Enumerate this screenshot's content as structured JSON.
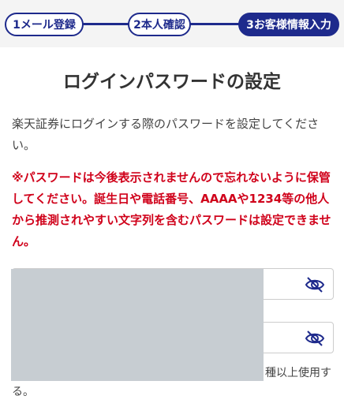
{
  "stepper": {
    "step1": "1メール登録",
    "step2": "2本人確認",
    "step3": "3お客様情報入力"
  },
  "page": {
    "title": "ログインパスワードの設定",
    "description": "楽天証券にログインする際のパスワードを設定してください。",
    "warning": "※パスワードは今後表示されませんので忘れないように保管してください。誕生日や電話番号、AAAAや1234等の他人から推測されやすい文字列を含むパスワードは設定できません。"
  },
  "fields": {
    "password": {
      "value": ""
    },
    "password_confirm": {
      "value": ""
    }
  },
  "hint": {
    "visible_part": "種以上使用す",
    "visible_part2": "る。"
  },
  "colors": {
    "accent": "#1e2a8c",
    "warning": "#d0021b"
  }
}
